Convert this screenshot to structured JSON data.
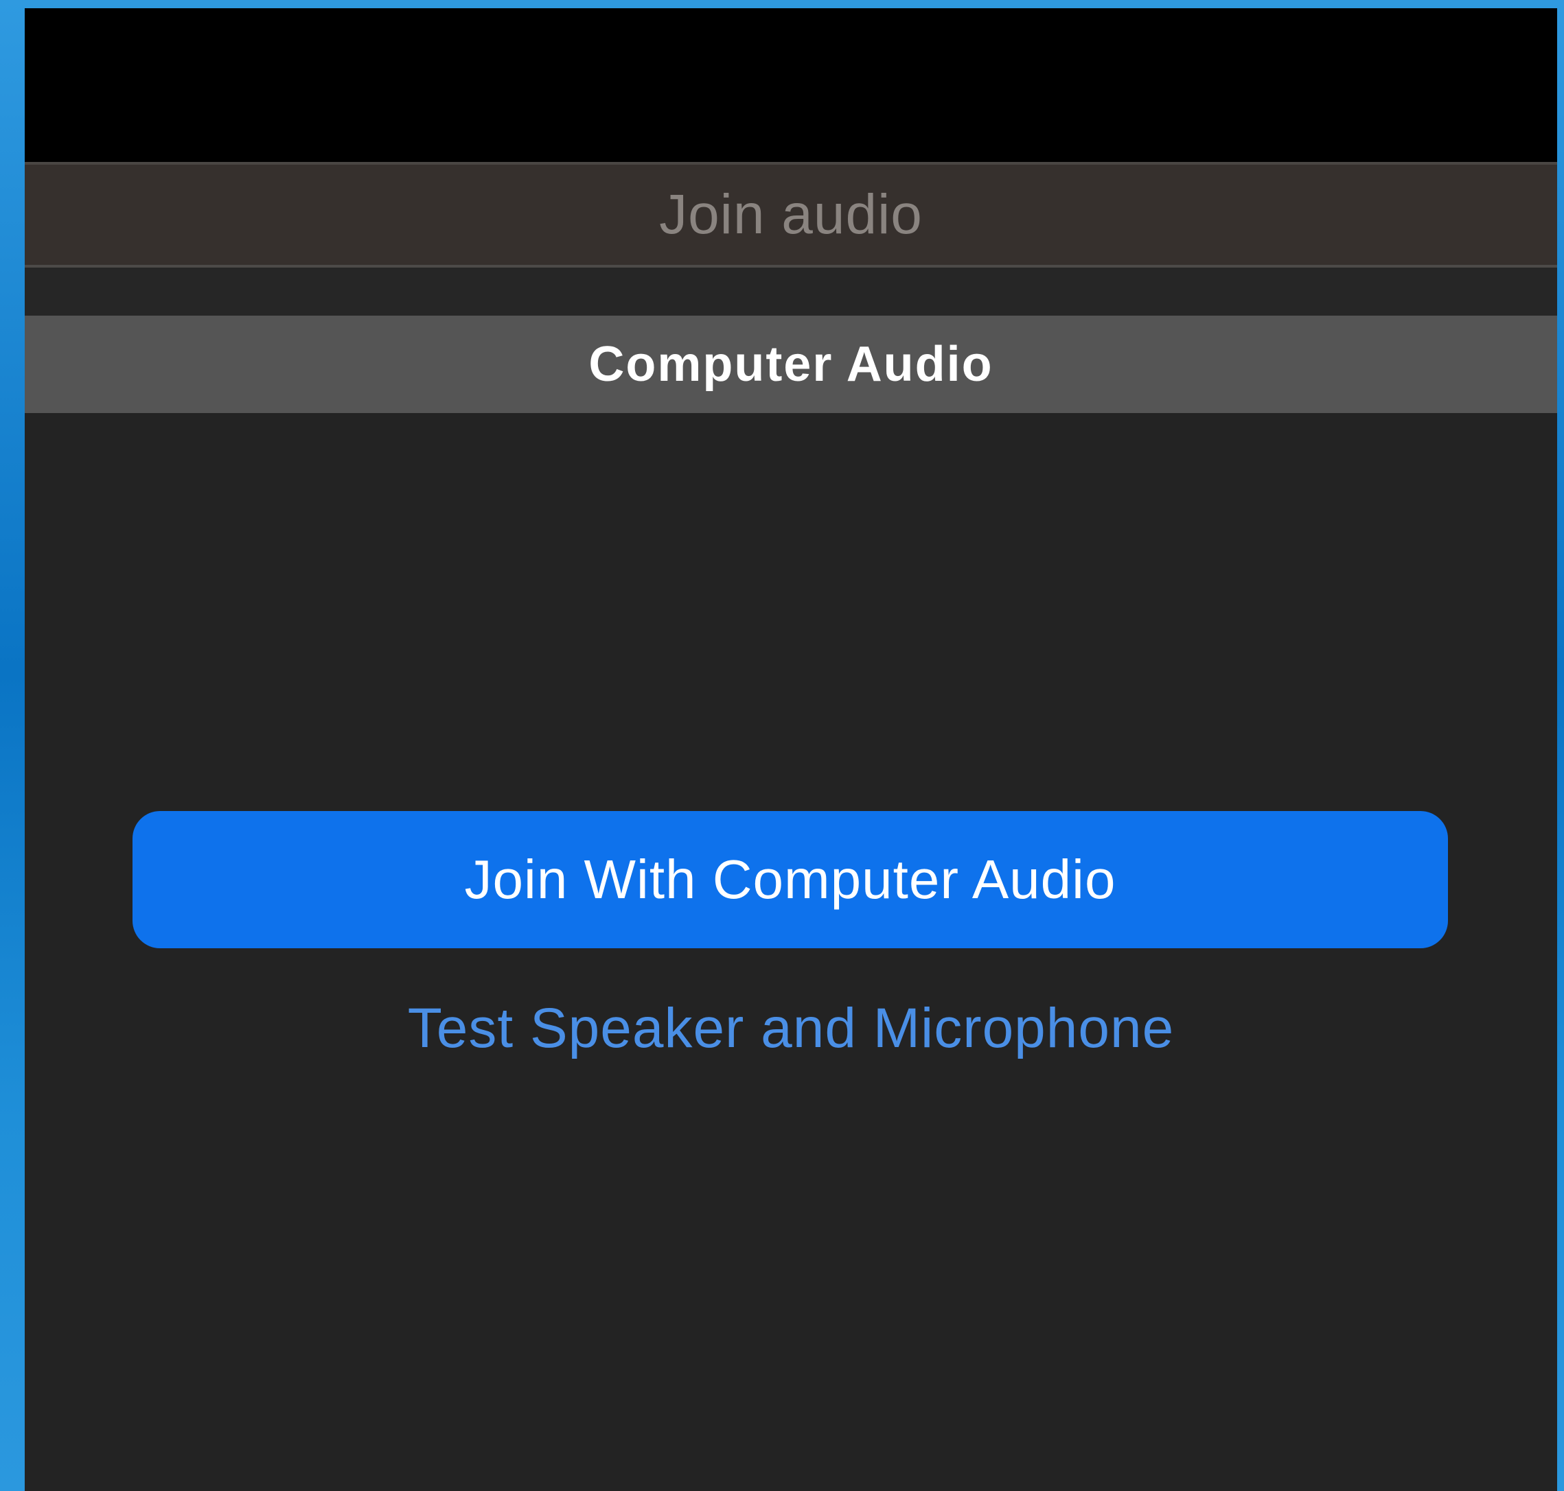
{
  "colors": {
    "desktop_blue": "#0a74c4",
    "window_background": "#232323",
    "title_bar": "#36302d",
    "tab_bar": "#555555",
    "primary_button": "#0e72ec",
    "link_blue": "#4a8fe6"
  },
  "dialog": {
    "title": "Join audio",
    "tabs": [
      {
        "label": "Computer Audio",
        "selected": true
      }
    ],
    "join_button_label": "Join With Computer Audio",
    "test_link_label": "Test Speaker and Microphone"
  }
}
